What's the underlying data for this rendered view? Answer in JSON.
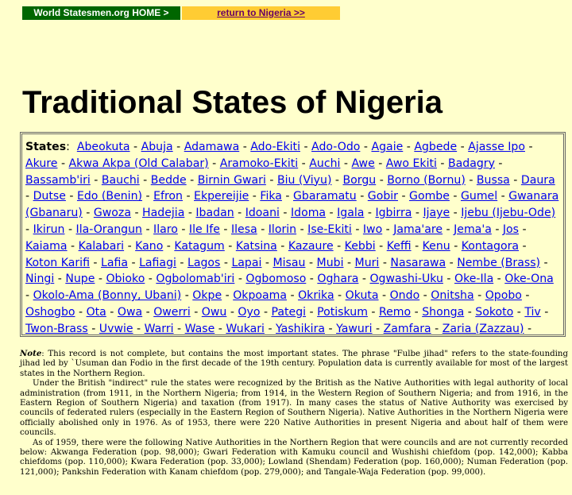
{
  "nav": {
    "home_label": "World Statesmen.org HOME >",
    "return_label": "return to Nigeria >>",
    "colors": {
      "home_bg": "#006600",
      "return_bg": "#FFCC33",
      "page_bg": "#FFFFCC",
      "link": "#0000EE"
    }
  },
  "page_title": "Traditional States of Nigeria",
  "states_label": "States",
  "states": [
    "Abeokuta",
    "Abuja",
    "Adamawa",
    "Ado-Ekiti",
    "Ado-Odo",
    "Agaie",
    "Agbede",
    "Ajasse Ipo",
    "Akure",
    "Akwa Akpa (Old Calabar)",
    "Aramoko-Ekiti",
    "Auchi",
    "Awe",
    "Awo Ekiti",
    "Badagry",
    "Bassamb'iri",
    "Bauchi",
    "Bedde",
    "Birnin Gwari",
    "Biu (Viyu)",
    "Borgu",
    "Borno (Bornu)",
    "Bussa",
    "Daura",
    "Dutse",
    "Edo (Benin)",
    "Efron",
    "Ekpereijie",
    "Fika",
    "Gbaramatu",
    "Gobir",
    "Gombe",
    "Gumel",
    "Gwanara (Gbanaru)",
    "Gwoza",
    "Hadejia",
    "Ibadan",
    "Idoani",
    "Idoma",
    "Igala",
    "Igbirra",
    "Ijaye",
    "Ijebu (Ijebu-Ode)",
    "Ikirun",
    "Ila-Orangun",
    "Ilaro",
    "Ile Ife",
    "Ilesa",
    "Ilorin",
    "Ise-Ekiti",
    "Iwo",
    "Jama'are",
    "Jema'a",
    "Jos",
    "Kaiama",
    "Kalabari",
    "Kano",
    "Katagum",
    "Katsina",
    "Kazaure",
    "Kebbi",
    "Keffi",
    "Kenu",
    "Kontagora",
    "Koton Karifi",
    "Lafia",
    "Lafiagi",
    "Lagos",
    "Lapai",
    "Misau",
    "Mubi",
    "Muri",
    "Nasarawa",
    "Nembe (Brass)",
    "Ningi",
    "Nupe",
    "Obioko",
    "Ogbolomab'iri",
    "Ogbomoso",
    "Oghara",
    "Ogwashi-Uku",
    "Oke-Ila",
    "Oke-Ona",
    "Okolo-Ama (Bonny, Ubani)",
    "Okpe",
    "Okpoama",
    "Okrika",
    "Okuta",
    "Ondo",
    "Onitsha",
    "Opobo",
    "Oshogbo",
    "Ota",
    "Owa",
    "Owerri",
    "Owu",
    "Oyo",
    "Pategi",
    "Potiskum",
    "Remo",
    "Shonga",
    "Sokoto",
    "Tiv",
    "Twon-Brass",
    "Uvwie",
    "Warri",
    "Wase",
    "Wukari",
    "Yashikira",
    "Yawuri",
    "Zamfara",
    "Zaria (Zazzau)",
    "Zuru"
  ],
  "notes": {
    "note_label": "Note",
    "p1": ": This record is not complete, but contains the most important states. The phrase \"Fulbe jihad\" refers to the state-founding jihad led by `Usuman dan Fodio in the first decade of the 19th century. Population data is currently available for most of the largest states in the Northern Region.",
    "p2": "Under the British \"indirect\" rule the states were recognized by the British as the Native Authorities with legal authority of local administration (from 1911, in the Northern Nigeria; from 1914, in the Western Region of Southern Nigeria; and from 1916, in the Eastern Region of Southern Nigeria) and taxation (from 1917). In many cases the status of Native Authority was exercised by councils of federated rulers (especially in the Eastern Region of Southern Nigeria). Native Authorities in the Northern Nigeria were officially abolished only in 1976. As of 1953, there were 220 Native Authorities in present Nigeria and about half of them were councils.",
    "p3": "As of 1959, there were the following Native Authorities in the Northern Region that were councils and are not currently recorded below: Akwanga Federation (pop. 98,000); Gwari Federation with Kamuku council and Wushishi chiefdom (pop. 142,000); Kabba chiefdoms (pop. 110,000); Kwara Federation (pop. 33,000); Lowland (Shendam) Federation (pop. 160,000); Numan Federation (pop. 121,000); Pankshin Federation with Kanam chiefdom (pop. 279,000); and Tangale-Waja Federation (pop. 99,000)."
  }
}
